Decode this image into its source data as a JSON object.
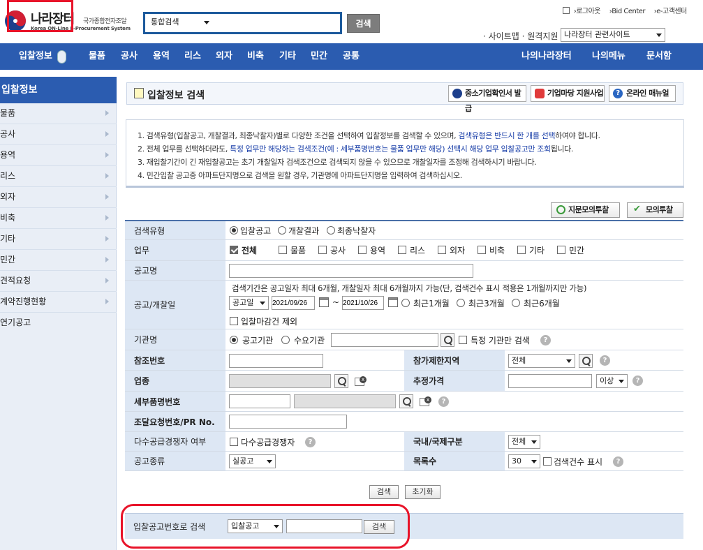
{
  "header": {
    "logo_title": "나라장터",
    "logo_sub_kr": "국가종합전자조달",
    "logo_sub_en": "Korea ON-Line E-Procurement System",
    "search_scope": "통합검색",
    "search_button": "검색",
    "util_links": [
      "로그아웃",
      "Bid Center",
      "e-고객센터"
    ],
    "sitemap_text": "· 사이트맵 · 원격지원",
    "related_site": "나라장터 관련사이트"
  },
  "nav": {
    "items": [
      "입찰정보",
      "물품",
      "공사",
      "용역",
      "리스",
      "외자",
      "비축",
      "기타",
      "민간",
      "공통"
    ],
    "right_items": [
      "나의나라장터",
      "나의메뉴",
      "문서함"
    ]
  },
  "sidebar": {
    "title": "입찰정보",
    "items": [
      "물품",
      "공사",
      "용역",
      "리스",
      "외자",
      "비축",
      "기타",
      "민간",
      "견적요청",
      "계약진행현황",
      "연기공고"
    ]
  },
  "page": {
    "title": "입찰정보 검색",
    "top_buttons": [
      "중소기업확인서 발급",
      "기업마당 지원사업",
      "온라인 매뉴얼"
    ],
    "notices": [
      {
        "pre": "1. 검색유형(입찰공고, 개찰결과, 최종낙찰자)별로 다양한 조건을 선택하여 입찰정보를 검색할 수 있으며, ",
        "hl": "검색유형은 반드시 한 개를 선택",
        "post": "하여야 합니다."
      },
      {
        "pre": "2. 전체 업무를 선택하더라도, ",
        "hl": "특정 업무만 해당하는 검색조건(예 : 세부품명번호는 물품 업무만 해당) 선택시 해당 업무 입찰공고만 조회",
        "post": "됩니다."
      },
      {
        "pre": "3. 재입찰기간이 긴 재입찰공고는 초기 개찰일자 검색조건으로 검색되지 않을 수 있으므로 개찰일자를 조정해 검색하시기 바랍니다.",
        "hl": "",
        "post": ""
      },
      {
        "pre": "4. 민간입찰 공고중 아파트단지명으로 검색을 원할 경우, 기관명에 아파트단지명을 입력하여 검색하십시오.",
        "hl": "",
        "post": ""
      }
    ],
    "action_buttons": [
      "지문모의투찰",
      "모의투찰"
    ]
  },
  "form": {
    "search_type": {
      "label": "검색유형",
      "options": [
        "입찰공고",
        "개찰결과",
        "최종낙찰자"
      ],
      "selected": "입찰공고"
    },
    "task": {
      "label": "업무",
      "options": [
        "전체",
        "물품",
        "공사",
        "용역",
        "리스",
        "외자",
        "비축",
        "기타",
        "민간"
      ],
      "checked": "전체"
    },
    "notice_name": {
      "label": "공고명",
      "value": ""
    },
    "date": {
      "label": "공고/개찰일",
      "info": "검색기간은 공고일자 최대 6개월, 개찰일자 최대 6개월까지 가능(단, 검색건수 표시 적용은 1개월까지만 가능)",
      "type": "공고일",
      "from": "2021/09/26",
      "tilde": "~",
      "to": "2021/10/26",
      "ranges": [
        "최근1개월",
        "최근3개월",
        "최근6개월"
      ],
      "exclude_closed": "입찰마감건 제외"
    },
    "agency": {
      "label": "기관명",
      "options": [
        "공고기관",
        "수요기관"
      ],
      "selected": "공고기관",
      "value": "",
      "specific_only": "특정 기관만 검색"
    },
    "ref_no": {
      "label": "참조번호",
      "value": ""
    },
    "region": {
      "label": "참가제한지역",
      "value": "전체"
    },
    "industry": {
      "label": "업종",
      "value": ""
    },
    "est_price": {
      "label": "추정가격",
      "value": "",
      "cond": "이상"
    },
    "detail_no": {
      "label": "세부품명번호",
      "value": ""
    },
    "pr_no": {
      "label": "조달요청번호/PR No.",
      "value": ""
    },
    "multi_supply": {
      "label": "다수공급경쟁자 여부",
      "check_label": "다수공급경쟁자"
    },
    "intl": {
      "label": "국내/국제구분",
      "value": "전체"
    },
    "notice_type": {
      "label": "공고종류",
      "value": "실공고"
    },
    "list_count": {
      "label": "목록수",
      "value": "30",
      "show_count": "검색건수 표시"
    }
  },
  "buttons": {
    "search": "검색",
    "reset": "초기화"
  },
  "bottom": {
    "label": "입찰공고번호로 검색",
    "type": "입찰공고",
    "value": "",
    "search": "검색"
  }
}
